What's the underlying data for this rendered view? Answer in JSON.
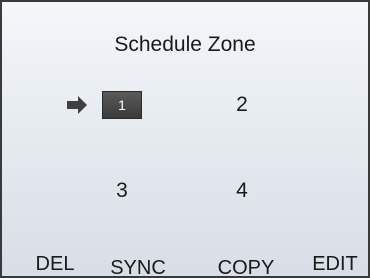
{
  "screen": {
    "title": "Schedule Zone"
  },
  "zones": [
    {
      "label": "1",
      "selected": true
    },
    {
      "label": "2",
      "selected": false
    },
    {
      "label": "3",
      "selected": false
    },
    {
      "label": "4",
      "selected": false
    }
  ],
  "cursor": {
    "icon": "arrow-right-icon",
    "points_to": "zone 1"
  },
  "softkeys": {
    "del": "DEL",
    "sync": "SYNC",
    "copy": "COPY",
    "edit": "EDIT"
  },
  "colors": {
    "background": "#e6ebf0",
    "selected_fill": "#444444",
    "selected_text": "#ffffff",
    "border": "#3a3a3a"
  }
}
